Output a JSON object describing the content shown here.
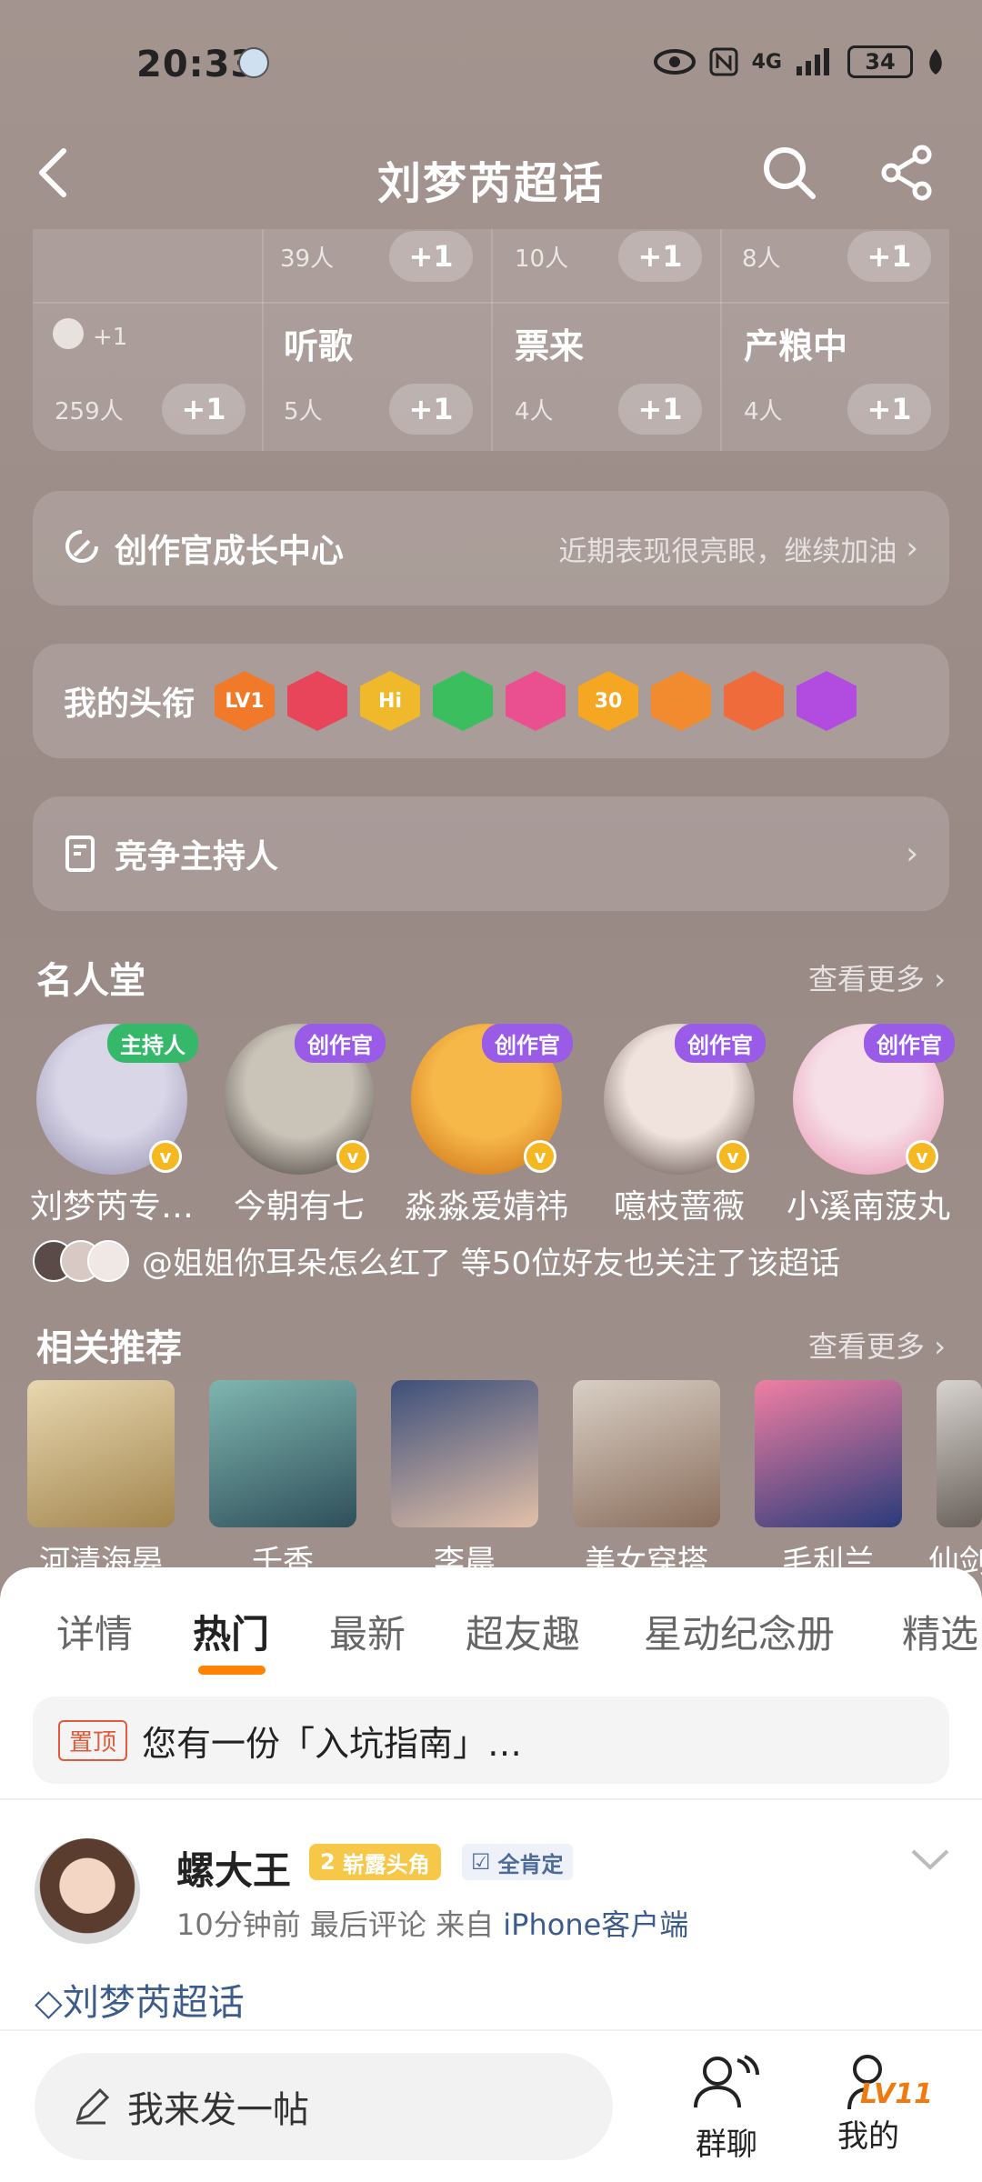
{
  "status_bar": {
    "time": "20:33",
    "network": "4G",
    "battery": "34"
  },
  "header": {
    "title": "刘梦芮超话"
  },
  "stats": {
    "row1": [
      {
        "count": "39人",
        "add": "+1"
      },
      {
        "count": "10人",
        "add": "+1"
      },
      {
        "count": "8人",
        "add": "+1"
      }
    ],
    "row2": [
      {
        "label": "",
        "extra": "+1",
        "count": "259人",
        "add": "+1"
      },
      {
        "label": "听歌",
        "count": "5人",
        "add": "+1"
      },
      {
        "label": "票来",
        "count": "4人",
        "add": "+1"
      },
      {
        "label": "产粮中",
        "count": "4人",
        "add": "+1"
      }
    ]
  },
  "growth_card": {
    "title": "创作官成长中心",
    "subtitle": "近期表现很亮眼，继续加油"
  },
  "titles_card": {
    "title": "我的头衔",
    "badges": [
      "LV1",
      "",
      "Hi",
      "",
      "",
      "30",
      "",
      "",
      ""
    ],
    "badge_colors": [
      "#f07a2a",
      "#e8455a",
      "#f0b92c",
      "#3bbf5e",
      "#ea4f8f",
      "#f5a623",
      "#f28a2f",
      "#f06b3c",
      "#b24be0"
    ]
  },
  "host_card": {
    "title": "竞争主持人"
  },
  "hall_of_fame": {
    "title": "名人堂",
    "more": "查看更多",
    "members": [
      {
        "name": "刘梦芮专…",
        "tag": "主持人",
        "tag_color": "#35b86a",
        "colors": [
          "#d9d6e8",
          "#8f8aa8"
        ]
      },
      {
        "name": "今朝有七",
        "tag": "创作官",
        "tag_color": "#9a5be6",
        "colors": [
          "#c9c3b8",
          "#3a3330"
        ]
      },
      {
        "name": "淼淼爱婧祎",
        "tag": "创作官",
        "tag_color": "#9a5be6",
        "colors": [
          "#f7b84a",
          "#c76a10"
        ]
      },
      {
        "name": "噫枝蔷薇",
        "tag": "创作官",
        "tag_color": "#9a5be6",
        "colors": [
          "#f0e3de",
          "#4b3a35"
        ]
      },
      {
        "name": "小溪南菠丸",
        "tag": "创作官",
        "tag_color": "#9a5be6",
        "colors": [
          "#f6dfe6",
          "#e88fae"
        ]
      }
    ],
    "friends_text": "@姐姐你耳朵怎么红了 等50位好友也关注了该超话"
  },
  "related": {
    "title": "相关推荐",
    "more": "查看更多",
    "items": [
      {
        "name": "河清海晏",
        "colors": [
          "#e8d7b0",
          "#a3864f"
        ]
      },
      {
        "name": "千香",
        "colors": [
          "#7fb6b0",
          "#2f4f5a"
        ]
      },
      {
        "name": "李晨",
        "colors": [
          "#3d4f7a",
          "#e2c0a8"
        ]
      },
      {
        "name": "美女穿搭",
        "colors": [
          "#d9cfc5",
          "#8a6e5c"
        ]
      },
      {
        "name": "毛利兰",
        "colors": [
          "#f07fa3",
          "#2a3b7a"
        ]
      },
      {
        "name": "仙剑",
        "colors": [
          "#d7d3cf",
          "#6b625c"
        ]
      }
    ]
  },
  "tabs": [
    "详情",
    "热门",
    "最新",
    "超友趣",
    "星动纪念册",
    "精选"
  ],
  "active_tab": "热门",
  "pinned": {
    "tag": "置顶",
    "text": "您有一份「入坑指南」…"
  },
  "post": {
    "username": "螺大王",
    "level_badge": "崭露头角",
    "level_num": "2",
    "cert_badge": "全肯定",
    "time": "10分钟前",
    "last_comment": "最后评论",
    "source_prefix": "来自",
    "source": "iPhone客户端",
    "topic": "刘梦芮超话"
  },
  "bottom_bar": {
    "compose": "我来发一帖",
    "group_chat": "群聊",
    "mine": "我的",
    "level": "LV11"
  }
}
